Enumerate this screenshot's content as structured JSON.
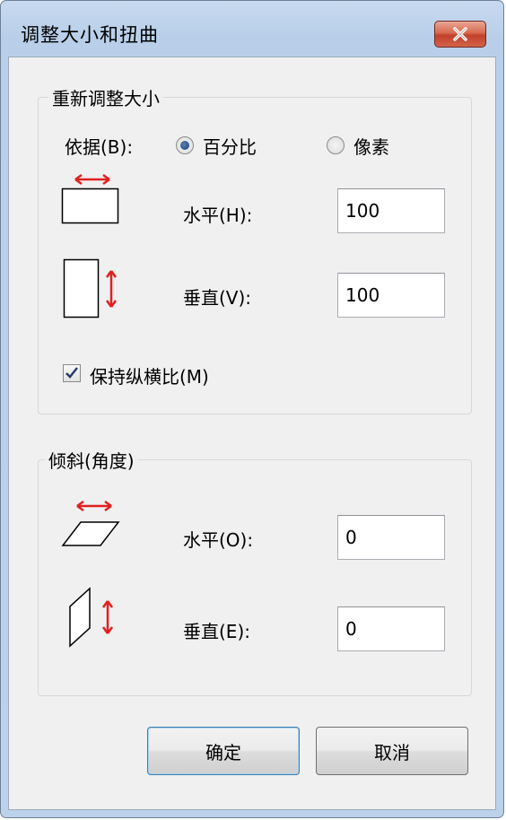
{
  "window": {
    "title": "调整大小和扭曲"
  },
  "resize": {
    "legend": "重新调整大小",
    "by_label": "依据(B):",
    "option_percent": "百分比",
    "option_pixels": "像素",
    "selected": "百分比",
    "horizontal_label": "水平(H):",
    "horizontal_value": "100",
    "vertical_label": "垂直(V):",
    "vertical_value": "100",
    "keep_ratio_label": "保持纵横比(M)",
    "keep_ratio_checked": true
  },
  "skew": {
    "legend": "倾斜(角度)",
    "horizontal_label": "水平(O):",
    "horizontal_value": "0",
    "vertical_label": "垂直(E):",
    "vertical_value": "0"
  },
  "buttons": {
    "ok": "确定",
    "cancel": "取消"
  },
  "colors": {
    "arrow": "#e02020",
    "close": "#c7432b"
  }
}
